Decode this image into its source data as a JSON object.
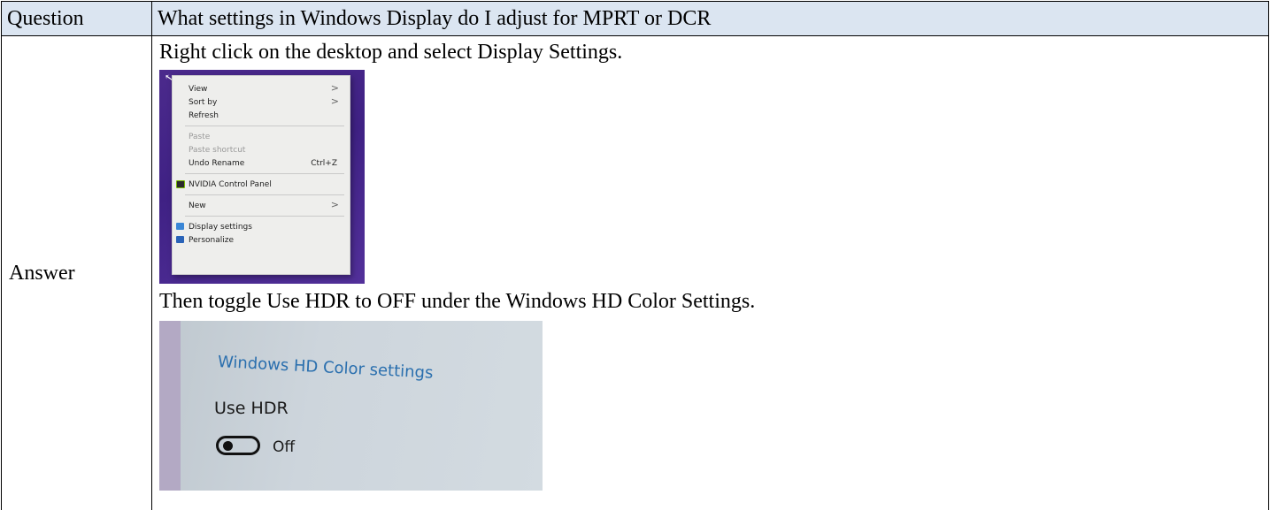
{
  "question": {
    "label": "Question",
    "text": "What settings in Windows Display do I adjust for MPRT or DCR"
  },
  "answer": {
    "label": "Answer",
    "step1": "Right click on the desktop and select Display Settings.",
    "step2": "Then toggle Use HDR to OFF under the Windows HD Color Settings."
  },
  "context_menu": {
    "items": [
      {
        "label": "View",
        "submenu": ">"
      },
      {
        "label": "Sort by",
        "submenu": ">"
      },
      {
        "label": "Refresh"
      },
      {
        "label": "Paste",
        "disabled": true
      },
      {
        "label": "Paste shortcut",
        "disabled": true
      },
      {
        "label": "Undo Rename",
        "shortcut": "Ctrl+Z"
      },
      {
        "label": "NVIDIA Control Panel",
        "icon": "nvidia-icon"
      },
      {
        "label": "New",
        "submenu": ">"
      },
      {
        "label": "Display settings",
        "icon": "display-icon"
      },
      {
        "label": "Personalize",
        "icon": "personalize-icon"
      }
    ]
  },
  "hdr_settings": {
    "heading": "Windows HD Color settings",
    "option_label": "Use HDR",
    "toggle_state": "Off"
  },
  "colors": {
    "question_row_bg": "#dbe5f1",
    "desktop_purple": "#4b2a8c",
    "settings_heading": "#2a6fae"
  }
}
